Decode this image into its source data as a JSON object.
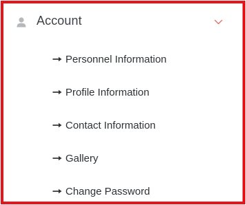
{
  "header": {
    "title": "Account",
    "icon": "user-icon",
    "toggle_icon": "chevron-down-icon"
  },
  "menu": {
    "arrow_icon": "arrow-right-icon",
    "items": [
      {
        "label": "Personnel Information"
      },
      {
        "label": "Profile Information"
      },
      {
        "label": "Contact Information"
      },
      {
        "label": "Gallery"
      },
      {
        "label": "Change Password"
      }
    ]
  },
  "colors": {
    "border": "#e8141c",
    "chevron": "#e0736a",
    "icon": "#b5b9bd",
    "text": "#2f3235"
  }
}
